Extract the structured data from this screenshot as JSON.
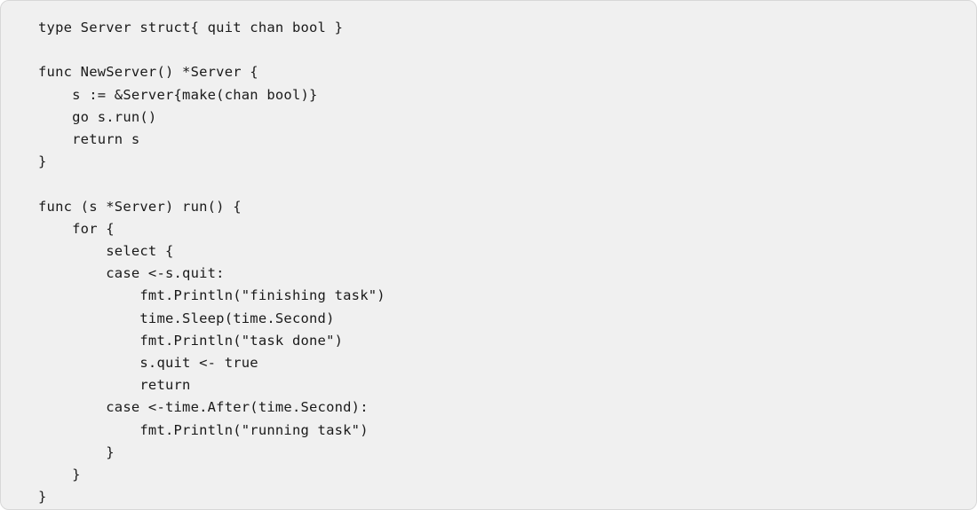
{
  "code": "type Server struct{ quit chan bool }\n\nfunc NewServer() *Server {\n    s := &Server{make(chan bool)}\n    go s.run()\n    return s\n}\n\nfunc (s *Server) run() {\n    for {\n        select {\n        case <-s.quit:\n            fmt.Println(\"finishing task\")\n            time.Sleep(time.Second)\n            fmt.Println(\"task done\")\n            s.quit <- true\n            return\n        case <-time.After(time.Second):\n            fmt.Println(\"running task\")\n        }\n    }\n}"
}
